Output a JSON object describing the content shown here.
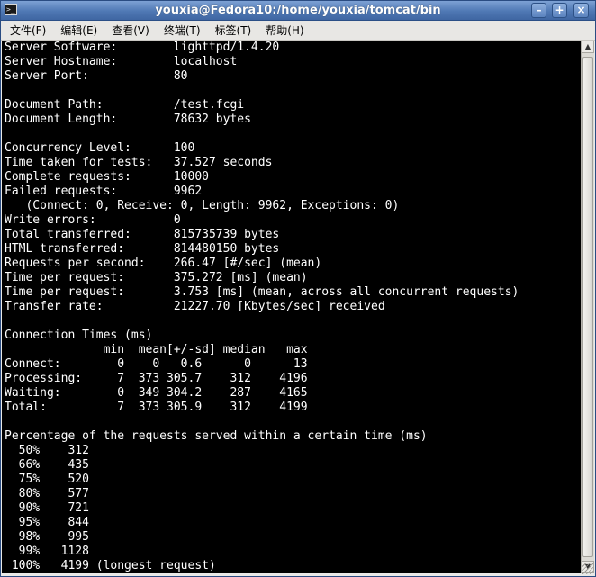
{
  "window": {
    "title": "youxia@Fedora10:/home/youxia/tomcat/bin",
    "app_icon": "terminal-icon",
    "buttons": {
      "minimize": "–",
      "maximize": "+",
      "close": "×"
    }
  },
  "menubar": {
    "items": [
      "文件(F)",
      "编辑(E)",
      "查看(V)",
      "终端(T)",
      "标签(T)",
      "帮助(H)"
    ]
  },
  "terminal": {
    "foreground": "#ffffff",
    "background": "#000000",
    "lines": [
      "Server Software:        lighttpd/1.4.20",
      "Server Hostname:        localhost",
      "Server Port:            80",
      "",
      "Document Path:          /test.fcgi",
      "Document Length:        78632 bytes",
      "",
      "Concurrency Level:      100",
      "Time taken for tests:   37.527 seconds",
      "Complete requests:      10000",
      "Failed requests:        9962",
      "   (Connect: 0, Receive: 0, Length: 9962, Exceptions: 0)",
      "Write errors:           0",
      "Total transferred:      815735739 bytes",
      "HTML transferred:       814480150 bytes",
      "Requests per second:    266.47 [#/sec] (mean)",
      "Time per request:       375.272 [ms] (mean)",
      "Time per request:       3.753 [ms] (mean, across all concurrent requests)",
      "Transfer rate:          21227.70 [Kbytes/sec] received",
      "",
      "Connection Times (ms)",
      "              min  mean[+/-sd] median   max",
      "Connect:        0    0   0.6      0      13",
      "Processing:     7  373 305.7    312    4196",
      "Waiting:        0  349 304.2    287    4165",
      "Total:          7  373 305.9    312    4199",
      "",
      "Percentage of the requests served within a certain time (ms)",
      "  50%    312",
      "  66%    435",
      "  75%    520",
      "  80%    577",
      "  90%    721",
      "  95%    844",
      "  98%    995",
      "  99%   1128",
      " 100%   4199 (longest request)"
    ]
  },
  "scrollbar": {
    "up_arrow": "▲",
    "down_arrow": "▼",
    "position": "bottom"
  }
}
